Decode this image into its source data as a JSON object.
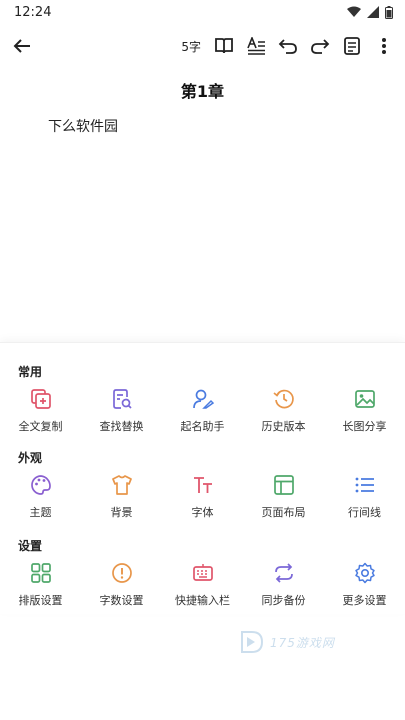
{
  "status_bar": {
    "time": "12:24"
  },
  "toolbar": {
    "word_count": "5字",
    "icons": [
      "back-arrow-icon",
      "book-icon",
      "text-format-icon",
      "undo-icon",
      "redo-icon",
      "note-icon",
      "more-vert-icon"
    ]
  },
  "editor": {
    "chapter_title": "第1章",
    "body": "下么软件园"
  },
  "panel": {
    "sections": [
      {
        "title": "常用",
        "items": [
          {
            "label": "全文复制",
            "icon": "copy-icon",
            "color": "#e0566b"
          },
          {
            "label": "查找替换",
            "icon": "search-doc-icon",
            "color": "#7b68d8"
          },
          {
            "label": "起名助手",
            "icon": "name-assistant-icon",
            "color": "#4a7be0"
          },
          {
            "label": "历史版本",
            "icon": "history-icon",
            "color": "#e8964a"
          },
          {
            "label": "长图分享",
            "icon": "image-share-icon",
            "color": "#4fa86a"
          }
        ]
      },
      {
        "title": "外观",
        "items": [
          {
            "label": "主题",
            "icon": "palette-icon",
            "color": "#8a5fd0"
          },
          {
            "label": "背景",
            "icon": "shirt-icon",
            "color": "#e8964a"
          },
          {
            "label": "字体",
            "icon": "font-icon",
            "color": "#e0566b"
          },
          {
            "label": "页面布局",
            "icon": "layout-icon",
            "color": "#4fa86a"
          },
          {
            "label": "行间线",
            "icon": "line-spacing-icon",
            "color": "#4a7be0"
          }
        ]
      },
      {
        "title": "设置",
        "items": [
          {
            "label": "排版设置",
            "icon": "grid-layout-icon",
            "color": "#4fa86a"
          },
          {
            "label": "字数设置",
            "icon": "alert-circle-icon",
            "color": "#e8964a"
          },
          {
            "label": "快捷输入栏",
            "icon": "keyboard-icon",
            "color": "#e0566b"
          },
          {
            "label": "同步备份",
            "icon": "sync-icon",
            "color": "#7b68d8"
          },
          {
            "label": "更多设置",
            "icon": "gear-icon",
            "color": "#4a7be0"
          }
        ]
      }
    ]
  },
  "watermark": {
    "text": "175游戏网"
  }
}
